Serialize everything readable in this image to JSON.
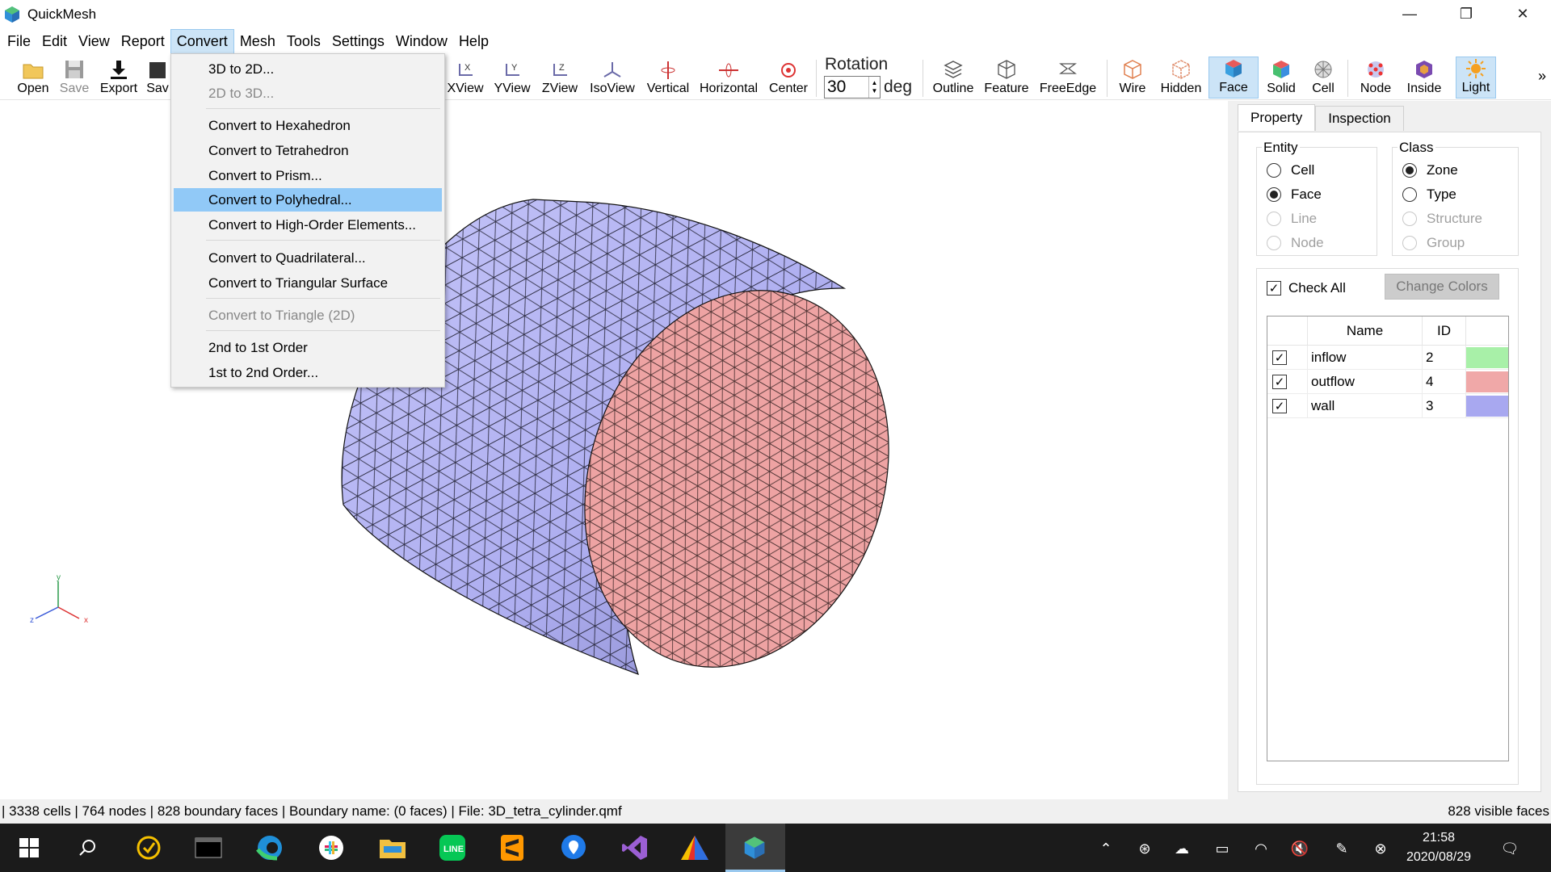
{
  "window": {
    "title": "QuickMesh",
    "minimize": "—",
    "maximize": "❐",
    "close": "✕"
  },
  "menubar": [
    "File",
    "Edit",
    "View",
    "Report",
    "Convert",
    "Mesh",
    "Tools",
    "Settings",
    "Window",
    "Help"
  ],
  "toolbar": {
    "open": "Open",
    "save": "Save",
    "export": "Export",
    "save_partial": "Sav",
    "xview": "XView",
    "yview": "YView",
    "zview": "ZView",
    "isoview": "IsoView",
    "vertical": "Vertical",
    "horizontal": "Horizontal",
    "center": "Center",
    "rotation_label": "Rotation",
    "rotation_value": "30",
    "rotation_unit": "deg",
    "outline": "Outline",
    "feature": "Feature",
    "freeedge": "FreeEdge",
    "wire": "Wire",
    "hidden": "Hidden",
    "face": "Face",
    "solid": "Solid",
    "cell": "Cell",
    "node": "Node",
    "inside": "Inside",
    "light": "Light",
    "more": "»"
  },
  "convert_menu": [
    {
      "label": "3D to 2D...",
      "disabled": false
    },
    {
      "label": "2D to 3D...",
      "disabled": true
    },
    {
      "label": "Convert to Hexahedron",
      "disabled": false
    },
    {
      "label": "Convert to Tetrahedron",
      "disabled": false
    },
    {
      "label": "Convert to Prism...",
      "disabled": false
    },
    {
      "label": "Convert to Polyhedral...",
      "disabled": false,
      "highlighted": true
    },
    {
      "label": "Convert to High-Order Elements...",
      "disabled": false
    },
    {
      "label": "Convert to Quadrilateral...",
      "disabled": false
    },
    {
      "label": "Convert to Triangular Surface",
      "disabled": false
    },
    {
      "label": "Convert to Triangle (2D)",
      "disabled": true
    },
    {
      "label": "2nd to 1st Order",
      "disabled": false
    },
    {
      "label": "1st to 2nd Order...",
      "disabled": false
    }
  ],
  "axes": {
    "x": "x",
    "y": "y",
    "z": "z"
  },
  "panel": {
    "tabs": [
      "Property",
      "Inspection"
    ],
    "entity": {
      "title": "Entity",
      "options": [
        "Cell",
        "Face",
        "Line",
        "Node"
      ],
      "selected": "Face"
    },
    "class": {
      "title": "Class",
      "options": [
        "Zone",
        "Type",
        "Structure",
        "Group"
      ],
      "selected": "Zone"
    },
    "check_all": "Check All",
    "change_colors": "Change Colors",
    "table": {
      "headers": [
        "Name",
        "ID"
      ],
      "rows": [
        {
          "name": "inflow",
          "id": "2",
          "color": "#a8f0a8"
        },
        {
          "name": "outflow",
          "id": "4",
          "color": "#f0a8a8"
        },
        {
          "name": "wall",
          "id": "3",
          "color": "#a8a8f0"
        }
      ]
    }
  },
  "status": {
    "left": "| 3338 cells | 764 nodes | 828 boundary faces |  Boundary name:  (0 faces) | File: 3D_tetra_cylinder.qmf",
    "right": "828 visible faces"
  },
  "taskbar": {
    "time": "21:58",
    "date": "2020/08/29"
  },
  "colors": {
    "wall": "#b4b4f5",
    "outflow": "#eea3a3",
    "menu_highlight": "#91c9f7",
    "accent": "#cce4f7"
  }
}
